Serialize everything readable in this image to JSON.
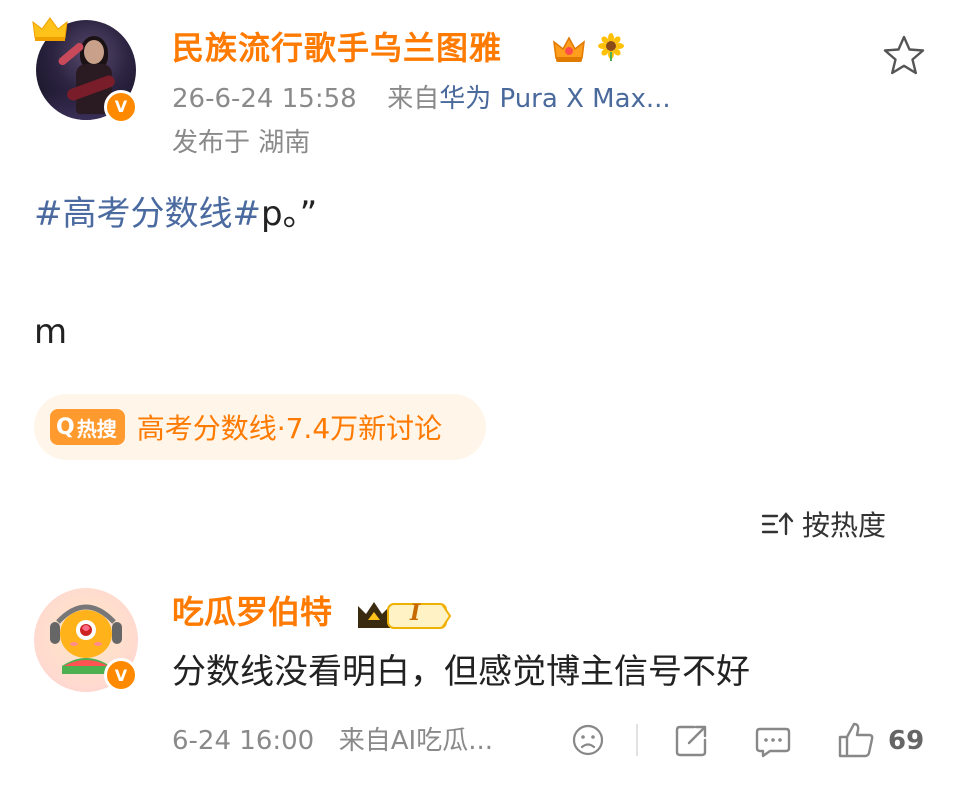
{
  "post": {
    "author": "民族流行歌手乌兰图雅",
    "date_time": "26-6-24 15:58",
    "source_prefix": "来自",
    "source_device": "华为 Pura X Max...",
    "location": "发布于 湖南",
    "hashtag": "#高考分数线#",
    "body_suffix": "p。”",
    "body_line2": "m",
    "badges": [
      "crown-badge-icon",
      "sunflower-icon"
    ],
    "verified": true
  },
  "hot_search": {
    "tag": "热搜",
    "text": "高考分数线·7.4万新讨论"
  },
  "comments_sort": {
    "label": "按热度"
  },
  "comment": {
    "author": "吃瓜罗伯特",
    "level": "I",
    "text": "分数线没看明白，但感觉博主信号不好",
    "date_time": "6-24 16:00",
    "source": "来自AI吃瓜...",
    "likes": "69"
  },
  "colors": {
    "accent_orange": "#ff7a00",
    "hashtag_blue": "#4a6aa0",
    "meta_gray": "#8a8a8a",
    "chip_bg": "#fff5e9"
  }
}
